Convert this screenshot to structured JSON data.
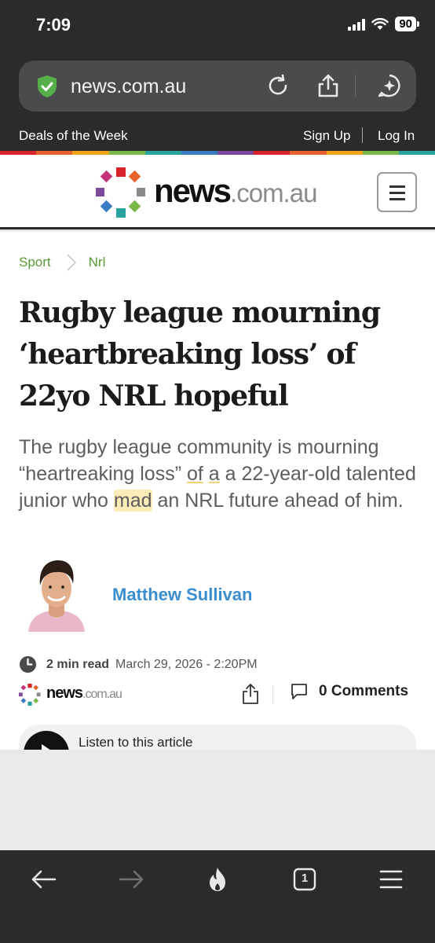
{
  "status_bar": {
    "time": "7:09",
    "battery": "90"
  },
  "address_bar": {
    "url": "news.com.au"
  },
  "top_strip": {
    "deals": "Deals of the Week",
    "sign_up": "Sign Up",
    "log_in": "Log In"
  },
  "masthead": {
    "brand_main": "news",
    "brand_domain": ".com.au"
  },
  "breadcrumb": {
    "section": "Sport",
    "subsection": "Nrl"
  },
  "article": {
    "headline": "Rugby league mourning ‘heartbreaking loss’ of 22yo NRL hopeful",
    "standfirst_parts": [
      "The rugby league community is mourning “heartreaking loss” ",
      "of",
      " ",
      "a",
      " a 22-year-old talented junior who ",
      "mad",
      " an NRL future ahead of him."
    ],
    "author": "Matthew Sullivan",
    "read_time": "2 min read",
    "date": "March 29, 2026 - 2:20PM",
    "comments": "0 Comments",
    "listen": "Listen to this article"
  },
  "colors": {
    "stripe": [
      "#d8232a",
      "#e8632b",
      "#f2a51c",
      "#7ab648",
      "#2aa3a0",
      "#3a7cc4",
      "#7c4a9c",
      "#d8232a",
      "#e8632b",
      "#f2a51c",
      "#7ab648",
      "#2aa3a0"
    ],
    "accent_green": "#5a9b32",
    "author_blue": "#3a8ed0"
  },
  "icons": {
    "address": [
      "shield-check-icon",
      "reload-icon",
      "share-icon",
      "ai-assistant-icon"
    ],
    "toolbar": [
      "back-arrow-icon",
      "forward-arrow-icon",
      "flame-icon",
      "tabs-icon",
      "menu-icon"
    ],
    "tabs_count": "1"
  }
}
